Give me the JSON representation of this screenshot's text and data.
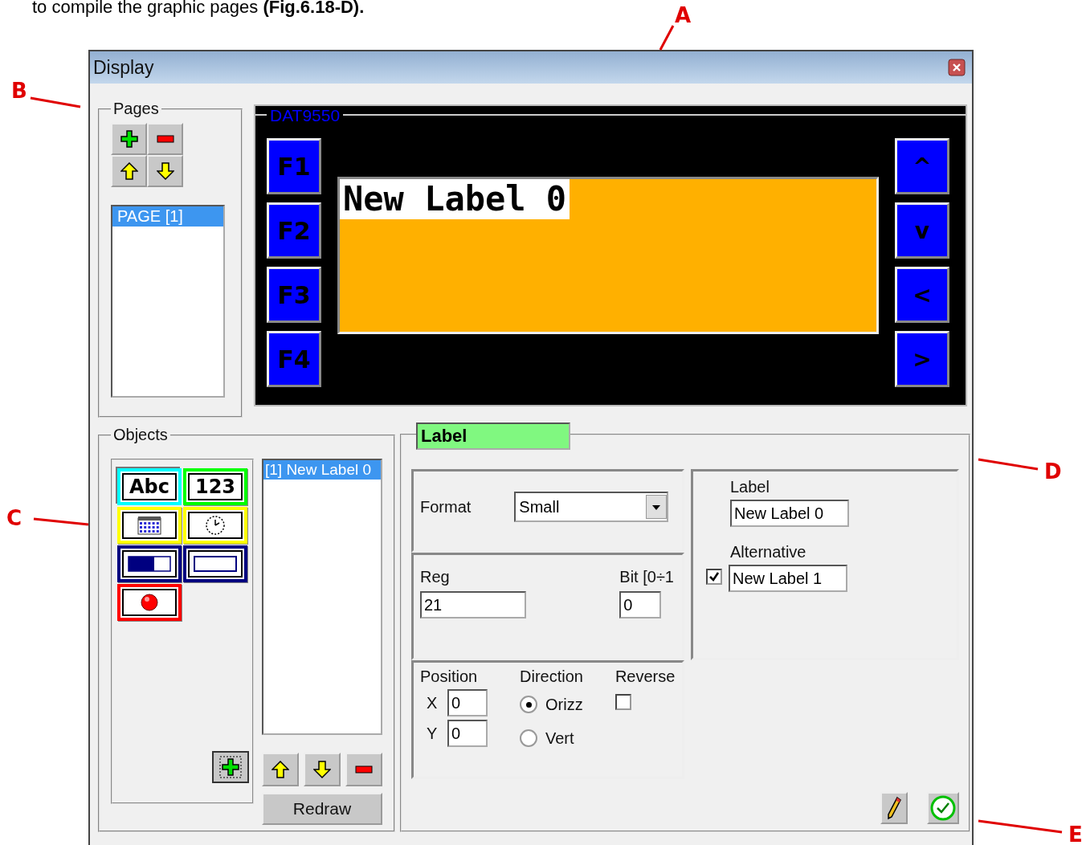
{
  "caption": "to compile the graphic pages  **(Fig.6.18-D).**",
  "callouts": [
    "A",
    "B",
    "C",
    "D",
    "E"
  ],
  "window": {
    "title": "Display"
  },
  "pages": {
    "title": "Pages",
    "items": [
      {
        "label": "PAGE [1]",
        "selected": true
      }
    ]
  },
  "device": {
    "title": "DAT9550",
    "function_keys": [
      "F1",
      "F2",
      "F3",
      "F4"
    ],
    "nav_keys": [
      "^",
      "v",
      "<",
      ">"
    ],
    "screen_label": "New Label 0"
  },
  "objects": {
    "title": "Objects",
    "tools": [
      {
        "kind": "text",
        "label": "Abc",
        "color": "#00ffff",
        "selected": true
      },
      {
        "kind": "number",
        "label": "123",
        "color": "#00ff00",
        "selected": false
      },
      {
        "kind": "date",
        "color": "#ffff00",
        "selected": false
      },
      {
        "kind": "clock",
        "color": "#ffff00",
        "selected": false
      },
      {
        "kind": "bar",
        "color": "#000080",
        "selected": false
      },
      {
        "kind": "field",
        "color": "#000080",
        "selected": false
      },
      {
        "kind": "lamp",
        "color": "#ff0000",
        "selected": false
      }
    ],
    "list": [
      {
        "label": "[1] New Label 0",
        "selected": true
      }
    ],
    "redraw": "Redraw"
  },
  "properties": {
    "type": "Label",
    "format_label": "Format",
    "format_value": "Small",
    "reg_label": "Reg",
    "reg_value": "21",
    "bit_label": "Bit [0÷1",
    "bit_value": "0",
    "label_title": "Label",
    "label_value": "New Label 0",
    "alternative_title": "Alternative",
    "alternative_checked": true,
    "alternative_value": "New Label 1",
    "position_label": "Position",
    "x_label": "X",
    "x_value": "0",
    "y_label": "Y",
    "y_value": "0",
    "direction_label": "Direction",
    "directions": [
      {
        "label": "Orizz",
        "selected": true
      },
      {
        "label": "Vert",
        "selected": false
      }
    ],
    "reverse_label": "Reverse",
    "reverse_checked": false
  }
}
